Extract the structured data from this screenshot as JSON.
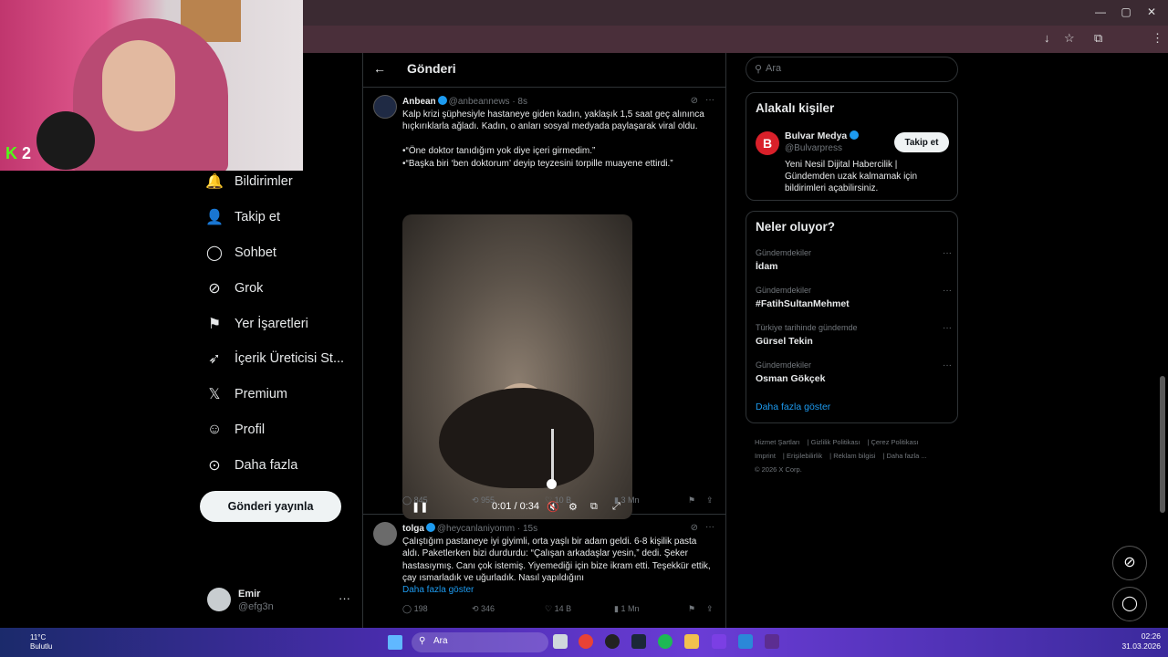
{
  "browser": {
    "window_controls": [
      "—",
      "▢",
      "✕"
    ],
    "toolbar_icons": [
      "↓",
      "☆",
      "⧉",
      "⋮"
    ]
  },
  "webcam": {
    "logo_k": "K",
    "logo_num": "2"
  },
  "sidebar": {
    "items": [
      {
        "icon": "bell-icon",
        "glyph": "🔔",
        "label": "Bildirimler"
      },
      {
        "icon": "add-user-icon",
        "glyph": "👤",
        "label": "Takip et"
      },
      {
        "icon": "chat-icon",
        "glyph": "◯",
        "label": "Sohbet"
      },
      {
        "icon": "grok-icon",
        "glyph": "⊘",
        "label": "Grok"
      },
      {
        "icon": "bookmark-icon",
        "glyph": "⚑",
        "label": "Yer İşaretleri"
      },
      {
        "icon": "rocket-icon",
        "glyph": "➶",
        "label": "İçerik Üreticisi St..."
      },
      {
        "icon": "x-logo-icon",
        "glyph": "𝕏",
        "label": "Premium"
      },
      {
        "icon": "profile-icon",
        "glyph": "☺",
        "label": "Profil"
      },
      {
        "icon": "more-circle-icon",
        "glyph": "⊙",
        "label": "Daha fazla"
      }
    ],
    "post_button": "Gönderi yayınla",
    "account": {
      "name": "Emir",
      "handle": "@efg3n",
      "more": "···"
    }
  },
  "main": {
    "back": "←",
    "title": "Gönderi",
    "tweets": [
      {
        "name": "Anbean",
        "handle": "@anbeannews · 8s",
        "text": "Kalp krizi şüphesiyle hastaneye giden kadın, yaklaşık 1,5 saat geç alınınca hıçkırıklarla ağladı. Kadın, o anları sosyal medyada paylaşarak viral oldu.",
        "quote1": "•“Öne doktor tanıdığım yok diye içeri girmedim.”",
        "quote2": "•“Başka biri ‘ben doktorum’ deyip teyzesini torpille muayene ettirdi.”",
        "video": {
          "time": "0:01 / 0:34",
          "progress": 0.03
        },
        "stats": {
          "replies": "845",
          "reposts": "955",
          "likes": "10 B",
          "views": "3 Mn"
        }
      },
      {
        "name": "tolga",
        "handle": "@heycanlaniyomm · 15s",
        "text": "Çalıştığım pastaneye iyi giyimli, orta yaşlı bir adam geldi. 6-8 kişilik pasta aldı. Paketlerken bizi durdurdu: “Çalışan arkadaşlar yesin,” dedi. Şeker hastasıymış. Canı çok istemiş. Yiyemediği için bize ikram etti. Teşekkür ettik, çay ısmarladık ve uğurladık. Nasıl yapıldığını",
        "show_more": "Daha fazla göster",
        "stats": {
          "replies": "198",
          "reposts": "346",
          "likes": "14 B",
          "views": "1 Mn"
        }
      }
    ]
  },
  "right": {
    "search_placeholder": "Ara",
    "related": {
      "title": "Alakalı kişiler",
      "name": "Bulvar Medya",
      "handle": "@Bulvarpress",
      "bio": "Yeni Nesil Dijital Habercilik | Gündemden uzak kalmamak için bildirimleri açabilirsiniz.",
      "follow": "Takip et",
      "avatar_letter": "B"
    },
    "trends": {
      "title": "Neler oluyor?",
      "items": [
        {
          "context": "Gündemdekiler",
          "topic": "İdam"
        },
        {
          "context": "Gündemdekiler",
          "topic": "#FatihSultanMehmet"
        },
        {
          "context": "Türkiye tarihinde gündemde",
          "topic": "Gürsel Tekin"
        },
        {
          "context": "Gündemdekiler",
          "topic": "Osman Gökçek"
        }
      ],
      "more": "Daha fazla göster"
    },
    "footer": [
      "Hizmet Şartları",
      "Gizlilik Politikası",
      "Çerez Politikası",
      "Imprint",
      "Erişilebilirlik",
      "Reklam bilgisi",
      "Daha fazla ...",
      "© 2026 X Corp."
    ]
  },
  "taskbar": {
    "temp": "11°C",
    "weather": "Bulutlu",
    "search": "Ara",
    "time": "02:26",
    "date": "31.03.2026"
  }
}
